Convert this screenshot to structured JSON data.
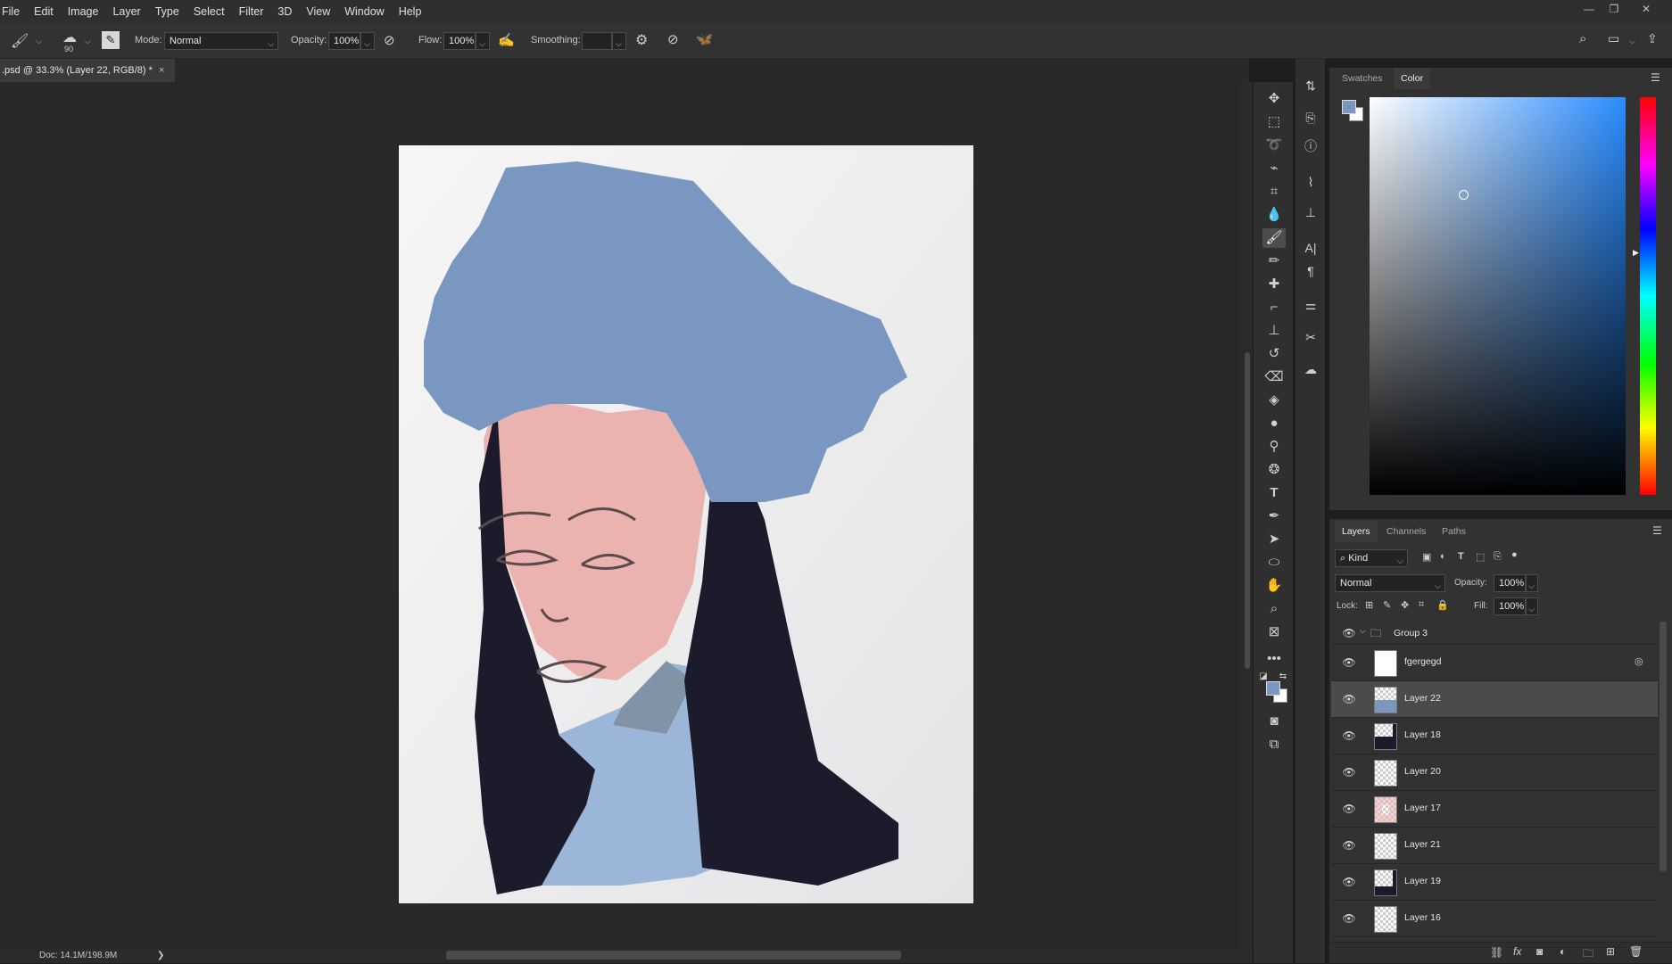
{
  "menu": [
    "File",
    "Edit",
    "Image",
    "Layer",
    "Type",
    "Select",
    "Filter",
    "3D",
    "View",
    "Window",
    "Help"
  ],
  "options": {
    "brush_size": "90",
    "mode_label": "Mode:",
    "mode_value": "Normal",
    "opacity_label": "Opacity:",
    "opacity_value": "100%",
    "flow_label": "Flow:",
    "flow_value": "100%",
    "smoothing_label": "Smoothing:",
    "smoothing_value": ""
  },
  "document_tab": {
    "title": ".psd @ 33.3% (Layer 22, RGB/8) *",
    "close": "×"
  },
  "status": {
    "doc": "Doc: 14.1M/198.9M",
    "arrow": "❯"
  },
  "color_panel": {
    "tabs": [
      "Swatches",
      "Color"
    ],
    "active_tab": "Color",
    "foreground": "#7b97c0",
    "background": "#ffffff"
  },
  "layers_panel": {
    "tabs": [
      "Layers",
      "Channels",
      "Paths"
    ],
    "filter_kind": "Kind",
    "blend_mode": "Normal",
    "opacity_label": "Opacity:",
    "opacity_value": "100%",
    "lock_label": "Lock:",
    "fill_label": "Fill:",
    "fill_value": "100%",
    "group": "Group 3",
    "layers": [
      {
        "name": "fgergegd",
        "selected": false
      },
      {
        "name": "Layer 22",
        "selected": true
      },
      {
        "name": "Layer 18",
        "selected": false
      },
      {
        "name": "Layer 20",
        "selected": false
      },
      {
        "name": "Layer 17",
        "selected": false
      },
      {
        "name": "Layer 21",
        "selected": false
      },
      {
        "name": "Layer 19",
        "selected": false
      },
      {
        "name": "Layer 16",
        "selected": false
      }
    ]
  },
  "artwork": {
    "hat_color": "#7a97c1",
    "skin_color": "#eab3b0",
    "hair_color": "#1b1b2b",
    "coat_color": "#9cb6da"
  }
}
